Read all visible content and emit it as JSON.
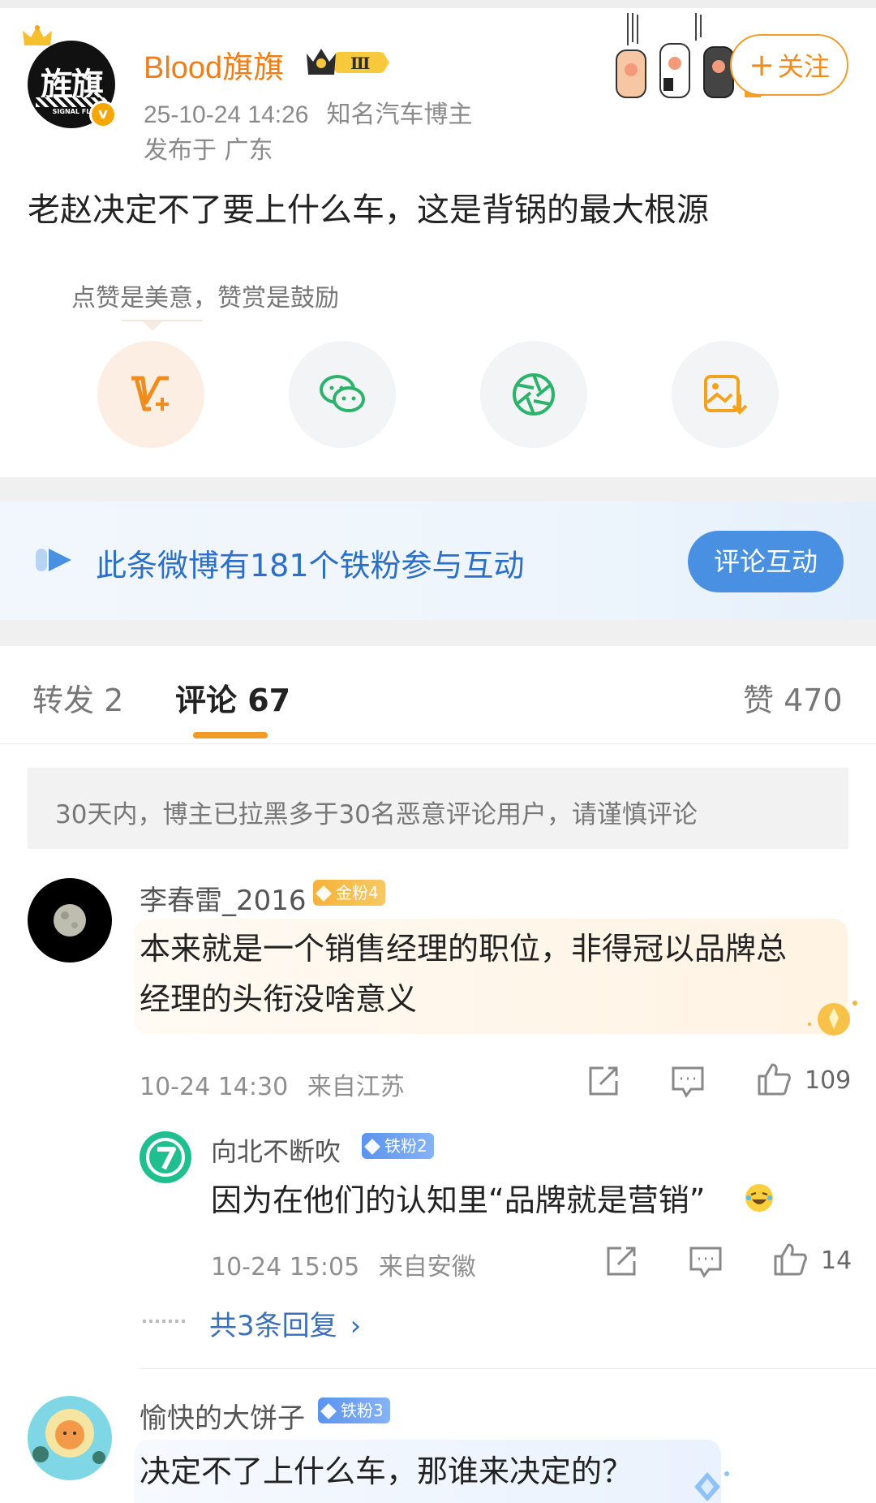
{
  "post": {
    "author": "Blood旗旗",
    "timestamp": "25-10-24 14:26",
    "author_title": "知名汽车博主",
    "location": "发布于 广东",
    "vip_level": "Ⅲ",
    "follow_label": "关注",
    "text": "老赵决定不了要上什么车，这是背锅的最大根源",
    "reward_hint": "点赞是美意，赞赏是鼓励"
  },
  "fans_banner": {
    "text": "此条微博有181个铁粉参与互动",
    "button_label": "评论互动"
  },
  "tabs": {
    "forward": "转发 2",
    "comments": "评论 67",
    "likes": "赞 470"
  },
  "notice": "30天内，博主已拉黑多于30名恶意评论用户，请谨慎评论",
  "comments": [
    {
      "user": "李春雷_2016",
      "badge": "金粉4",
      "text_line1": "本来就是一个销售经理的职位，非得冠以品牌总",
      "text_line2": "经理的头衔没啥意义",
      "time": "10-24 14:30",
      "source": "来自江苏",
      "likes": "109",
      "reply": {
        "user": "向北不断吹",
        "badge": "铁粉2",
        "text": "因为在他们的认知里“品牌就是营销”",
        "time": "10-24 15:05",
        "source": "来自安徽",
        "likes": "14"
      },
      "replies_link": "共3条回复"
    },
    {
      "user": "愉快的大饼子",
      "badge": "铁粉3",
      "text": "决定不了上什么车，那谁来决定的？"
    }
  ],
  "colors": {
    "accent_orange": "#f39b2a",
    "link_blue": "#3b6fb6",
    "button_blue": "#4a90e2"
  }
}
